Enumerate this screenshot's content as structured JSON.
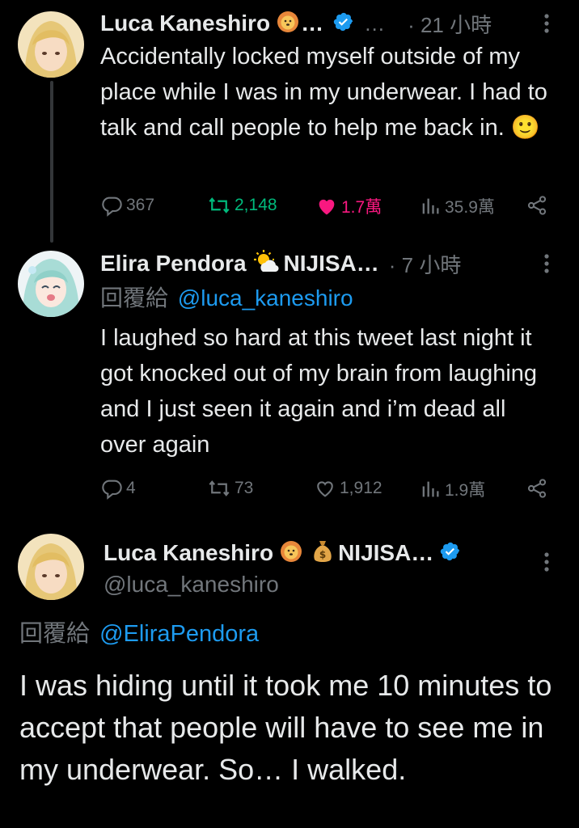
{
  "tweets": [
    {
      "author": "Luca Kaneshiro",
      "ellipsis1": "…",
      "ellipsis2": "…",
      "time": "· 21 小時",
      "text": "Accidentally locked myself outside of my place while I was in my underwear. I had to talk and call people to help me back in. 🙂",
      "replies": "367",
      "retweets": "2,148",
      "likes": "1.7萬",
      "views": "35.9萬",
      "colors": {
        "retweet": "#00ba7c",
        "like": "#f91880"
      }
    },
    {
      "author": "Elira Pendora",
      "suffix": "NIJISA…",
      "time": "· 7 小時",
      "reply_prefix": "回覆給",
      "reply_to": "@luca_kaneshiro",
      "text": "I laughed so hard at this tweet last night it got knocked out of my brain from laughing and I just seen it again and i’m dead all over again",
      "replies": "4",
      "retweets": "73",
      "likes": "1,912",
      "views": "1.9萬"
    },
    {
      "author": "Luca Kaneshiro",
      "suffix": "NIJISA…",
      "handle": "@luca_kaneshiro",
      "reply_prefix": "回覆給",
      "reply_to": "@EliraPendora",
      "text": "I was hiding until it took me 10 minutes to accept that people will have to see me in my underwear. So… I walked."
    }
  ],
  "colors": {
    "background": "#000000",
    "text": "#e7e9ea",
    "muted": "#71767b",
    "link": "#1d9bf0",
    "verified": "#1d9bf0"
  },
  "icons": [
    "reply-icon",
    "retweet-icon",
    "like-icon",
    "views-icon",
    "share-icon",
    "more-icon",
    "verified-icon",
    "lion-emoji-icon",
    "money-bag-emoji-icon",
    "sun-cloud-emoji-icon",
    "smile-emoji-icon"
  ]
}
